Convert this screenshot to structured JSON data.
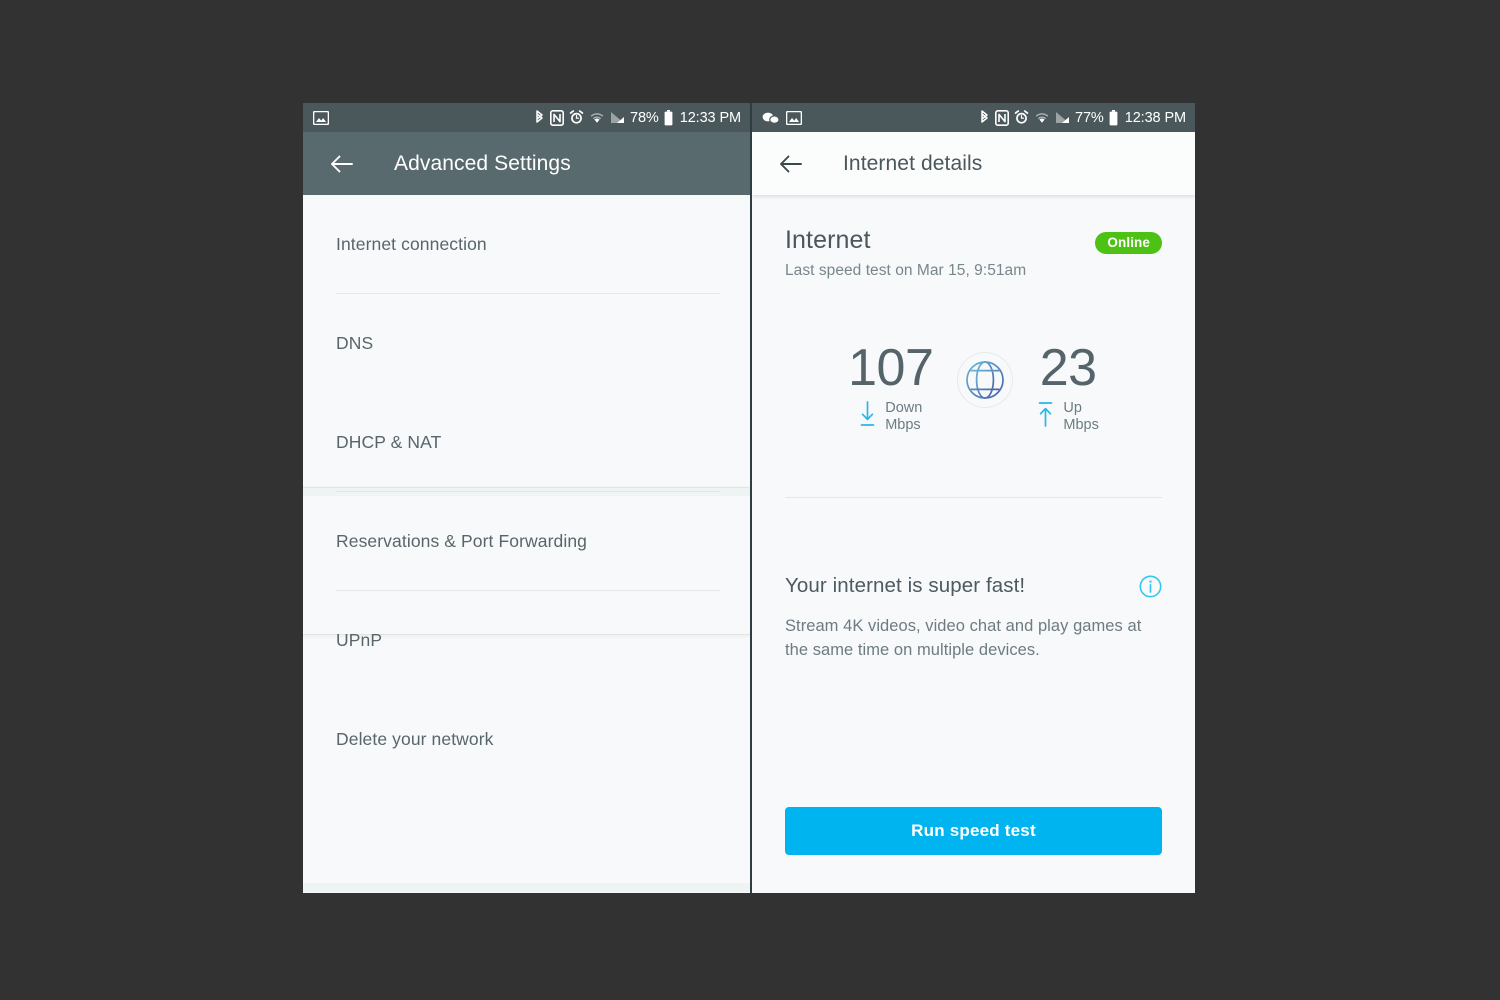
{
  "left_phone": {
    "statusbar": {
      "left_icons": [
        "image-icon"
      ],
      "right_icons": [
        "bluetooth-icon",
        "nfc-icon",
        "alarm-icon",
        "wifi-icon",
        "signal-icon"
      ],
      "battery_percent": "78%",
      "time": "12:33 PM"
    },
    "appbar": {
      "back_icon": "back-arrow-icon",
      "title": "Advanced Settings"
    },
    "menu": {
      "items": [
        {
          "label": "Internet connection"
        },
        {
          "label": "DNS"
        },
        {
          "label": "DHCP & NAT"
        },
        {
          "label": "Reservations & Port Forwarding"
        },
        {
          "label": "UPnP"
        },
        {
          "label": "Delete your network"
        }
      ]
    }
  },
  "right_phone": {
    "statusbar": {
      "left_icons": [
        "chat-bubbles-icon",
        "image-icon"
      ],
      "right_icons": [
        "bluetooth-icon",
        "nfc-icon",
        "alarm-icon",
        "wifi-icon",
        "signal-icon"
      ],
      "battery_percent": "77%",
      "time": "12:38 PM"
    },
    "appbar": {
      "back_icon": "back-arrow-icon",
      "title": "Internet details"
    },
    "detail": {
      "title": "Internet",
      "subtitle": "Last speed test on Mar 15, 9:51am",
      "status_badge": "Online",
      "status_color": "#4dc114",
      "speed": {
        "down": {
          "value": "107",
          "label": "Down",
          "unit": "Mbps",
          "icon": "download-arrow-icon"
        },
        "up": {
          "value": "23",
          "label": "Up",
          "unit": "Mbps",
          "icon": "upload-arrow-icon"
        },
        "center_icon": "globe-icon"
      },
      "message": {
        "title": "Your internet is super fast!",
        "body": "Stream 4K videos, video chat and play games at the same time on multiple devices.",
        "info_icon": "info-icon"
      },
      "cta_label": "Run speed test",
      "accent_color": "#00b5ef"
    }
  }
}
